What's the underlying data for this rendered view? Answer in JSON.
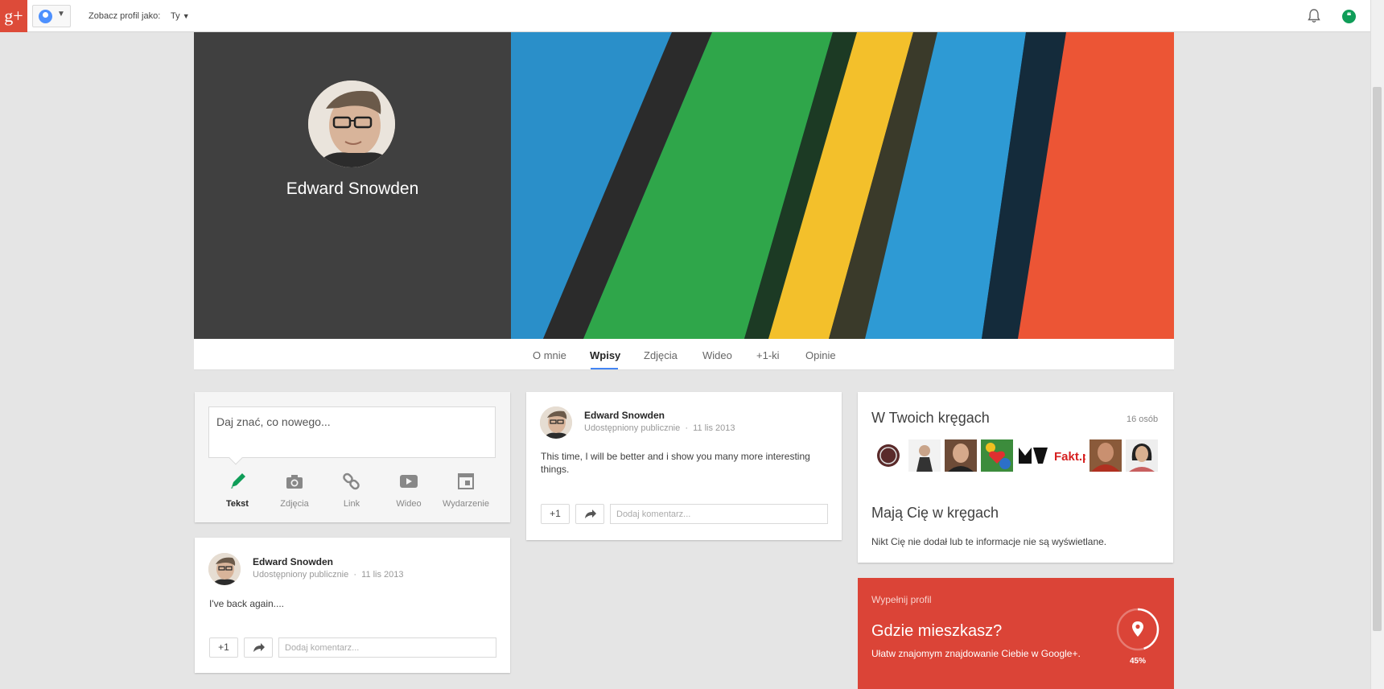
{
  "topbar": {
    "view_as_label": "Zobacz profil jako:",
    "view_as_value": "Ty",
    "logo": "g+"
  },
  "profile": {
    "name": "Edward Snowden"
  },
  "tabs": [
    {
      "label": "O mnie"
    },
    {
      "label": "Wpisy"
    },
    {
      "label": "Zdjęcia"
    },
    {
      "label": "Wideo"
    },
    {
      "label": "+1-ki"
    },
    {
      "label": "Opinie"
    }
  ],
  "share": {
    "placeholder": "Daj znać, co nowego...",
    "options": [
      "Tekst",
      "Zdjęcia",
      "Link",
      "Wideo",
      "Wydarzenie"
    ]
  },
  "posts": [
    {
      "author": "Edward Snowden",
      "visibility": "Udostępniony publicznie",
      "date": "11 lis 2013",
      "text": "This time, I will be better and i show you many more interesting things.",
      "plus_label": "+1",
      "comment_placeholder": "Dodaj komentarz..."
    },
    {
      "author": "Edward Snowden",
      "visibility": "Udostępniony publicznie",
      "date": "11 lis 2013",
      "text": "I've back again....",
      "plus_label": "+1",
      "comment_placeholder": "Dodaj komentarz..."
    }
  ],
  "circles": {
    "title": "W Twoich kręgach",
    "count": "16 osób",
    "thumb_brand": "Fakt.pl",
    "in_circles_title": "Mają Cię w kręgach",
    "in_circles_text": "Nikt Cię nie dodał lub te informacje nie są wyświetlane."
  },
  "complete_profile": {
    "label": "Wypełnij profil",
    "question": "Gdzie mieszkasz?",
    "subtitle": "Ułatw znajomym znajdowanie Ciebie w Google+.",
    "progress_label": "45%",
    "progress": 0.45
  },
  "colors": {
    "brand_red": "#dd4b39",
    "tab_accent": "#4285f4",
    "promo_red": "#db4437"
  }
}
